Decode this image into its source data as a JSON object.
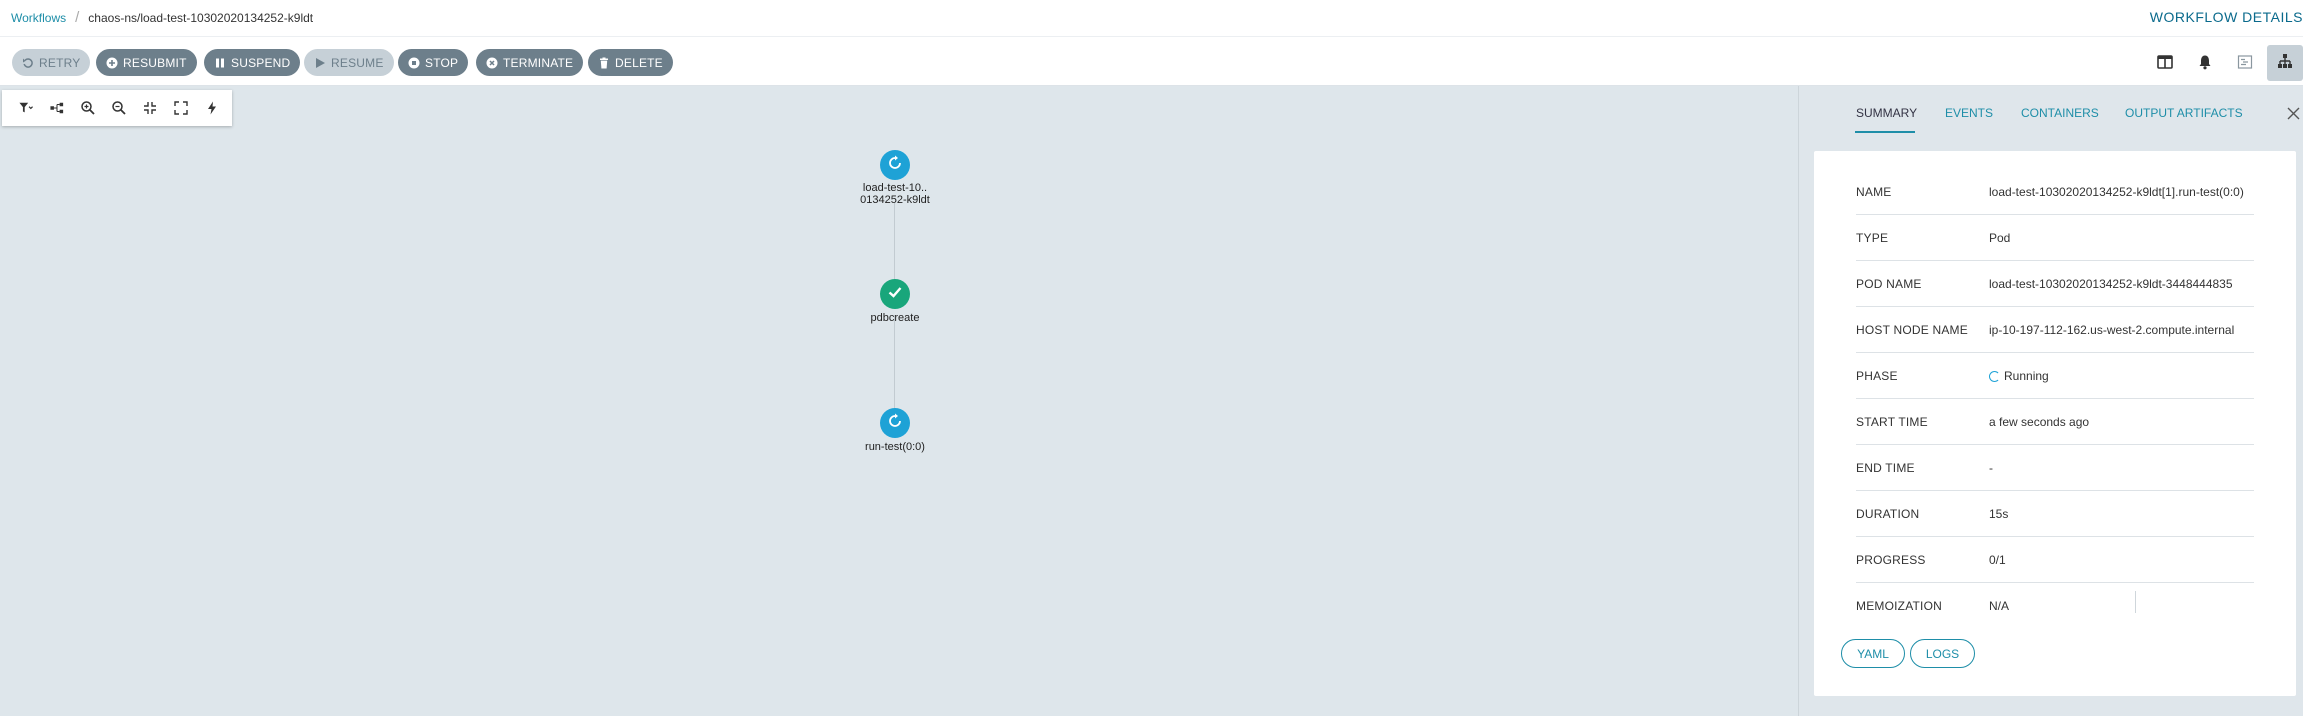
{
  "header": {
    "breadcrumb": {
      "root": "Workflows",
      "current": "chaos-ns/load-test-10302020134252-k9ldt"
    },
    "title": "WORKFLOW DETAILS"
  },
  "toolbar": {
    "buttons": [
      {
        "label": "RETRY",
        "icon": "undo-icon",
        "disabled": true
      },
      {
        "label": "RESUBMIT",
        "icon": "plus-circle-icon",
        "disabled": false
      },
      {
        "label": "SUSPEND",
        "icon": "pause-icon",
        "disabled": false
      },
      {
        "label": "RESUME",
        "icon": "play-icon",
        "disabled": true
      },
      {
        "label": "STOP",
        "icon": "stop-circle-icon",
        "disabled": false
      },
      {
        "label": "TERMINATE",
        "icon": "times-circle-icon",
        "disabled": false
      },
      {
        "label": "DELETE",
        "icon": "trash-icon",
        "disabled": false
      }
    ],
    "right_icons": [
      "split-view-icon",
      "bell-icon",
      "timeline-icon",
      "graph-icon"
    ]
  },
  "graph": {
    "tools": [
      "filter-icon",
      "layout-icon",
      "zoom-in-icon",
      "zoom-out-icon",
      "compress-icon",
      "expand-icon",
      "bolt-icon"
    ],
    "nodes": [
      {
        "label_line1": "load-test-10..",
        "label_line2": "0134252-k9ldt",
        "status": "running"
      },
      {
        "label_line1": "pdbcreate",
        "label_line2": "",
        "status": "succeeded"
      },
      {
        "label_line1": "run-test(0:0)",
        "label_line2": "",
        "status": "running"
      }
    ]
  },
  "side_panel": {
    "tabs": [
      "SUMMARY",
      "EVENTS",
      "CONTAINERS",
      "OUTPUT ARTIFACTS"
    ],
    "active_tab": "SUMMARY",
    "fields": [
      {
        "label": "NAME",
        "value": "load-test-10302020134252-k9ldt[1].run-test(0:0)"
      },
      {
        "label": "TYPE",
        "value": "Pod"
      },
      {
        "label": "POD NAME",
        "value": "load-test-10302020134252-k9ldt-3448444835"
      },
      {
        "label": "HOST NODE NAME",
        "value": "ip-10-197-112-162.us-west-2.compute.internal"
      },
      {
        "label": "PHASE",
        "value": "Running"
      },
      {
        "label": "START TIME",
        "value": "a few seconds ago"
      },
      {
        "label": "END TIME",
        "value": "-"
      },
      {
        "label": "DURATION",
        "value": "15s"
      },
      {
        "label": "PROGRESS",
        "value": "0/1"
      },
      {
        "label": "MEMOIZATION",
        "value": "N/A"
      }
    ],
    "buttons": {
      "yaml": "YAML",
      "logs": "LOGS"
    }
  },
  "colors": {
    "accent": "#1e8ea8",
    "button_bg": "#6d7f8b",
    "button_disabled_bg": "#c6d0d7",
    "running": "#1ea2d6",
    "succeeded": "#19a67b",
    "canvas_bg": "#dee6eb"
  }
}
